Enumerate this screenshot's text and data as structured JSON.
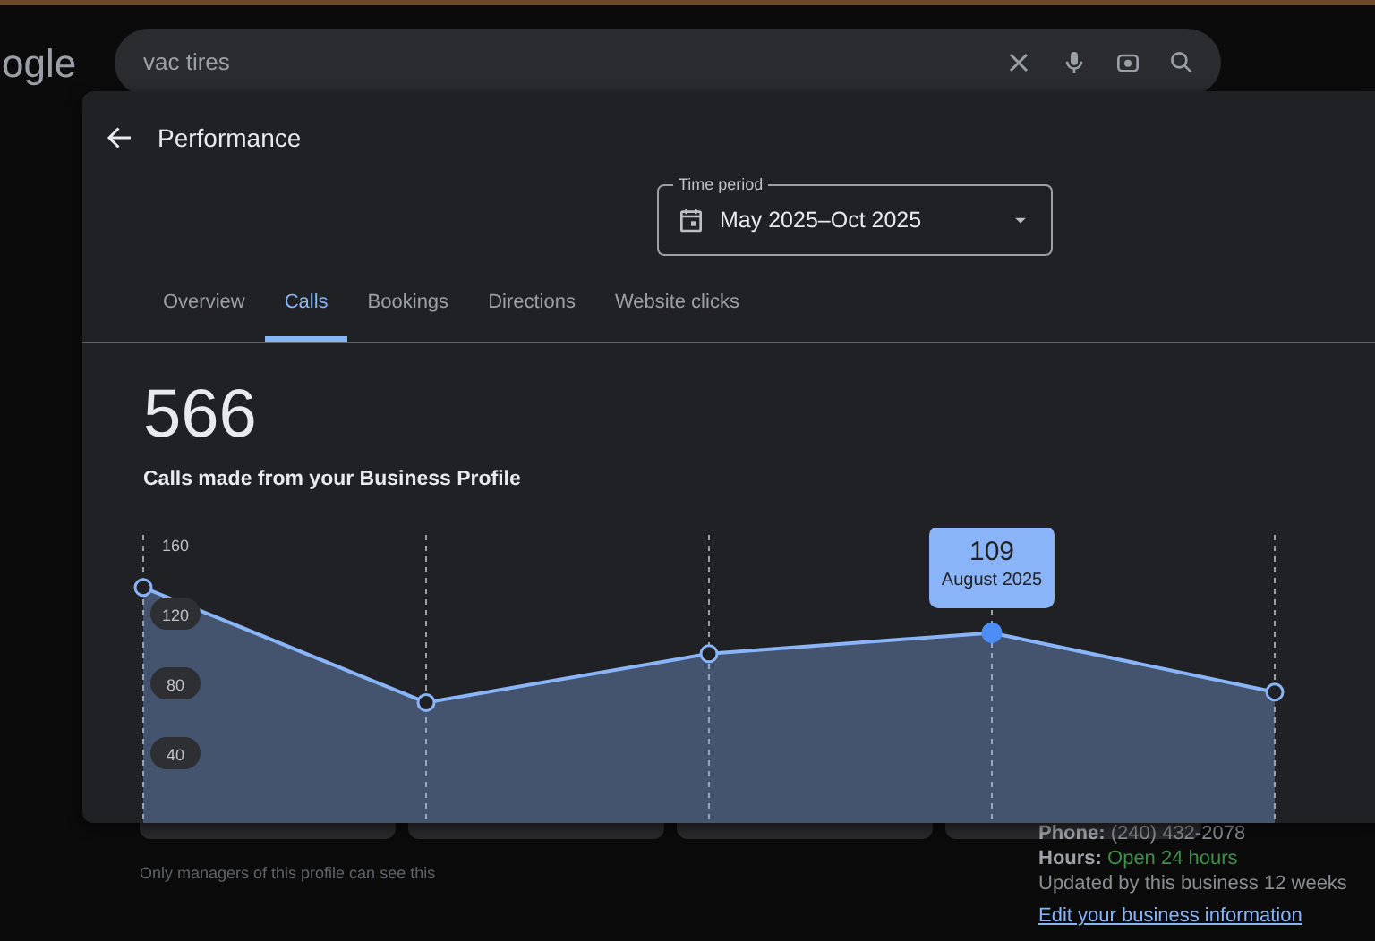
{
  "search": {
    "value": "vac tires"
  },
  "logo": "ogle",
  "background": {
    "note": "Only managers of this profile can see this",
    "phone_label": "Phone:",
    "phone": "(240) 432-2078",
    "hours_label": "Hours:",
    "hours": "Open 24 hours",
    "updated": "Updated by this business 12 weeks",
    "edit_link": "Edit your business information"
  },
  "panel": {
    "title": "Performance",
    "time_period": {
      "label": "Time period",
      "value": "May 2025–Oct 2025"
    },
    "tabs": [
      {
        "label": "Overview",
        "selected": false
      },
      {
        "label": "Calls",
        "selected": true
      },
      {
        "label": "Bookings",
        "selected": false
      },
      {
        "label": "Directions",
        "selected": false
      },
      {
        "label": "Website clicks",
        "selected": false
      }
    ],
    "total": "566",
    "total_caption": "Calls made from your Business Profile",
    "chart_data": {
      "type": "area",
      "ylim": [
        0,
        160
      ],
      "yticks": [
        40,
        80,
        120,
        160
      ],
      "grid": true,
      "series": [
        {
          "color": "#8ab4f8",
          "values": [
            135,
            69,
            97,
            109,
            75
          ]
        }
      ]
    },
    "points": [
      {
        "selected": false
      },
      {
        "selected": false
      },
      {
        "selected": false
      },
      {
        "selected": true
      },
      {
        "selected": false
      }
    ],
    "tooltip": {
      "value": "109",
      "label": "August 2025"
    }
  }
}
